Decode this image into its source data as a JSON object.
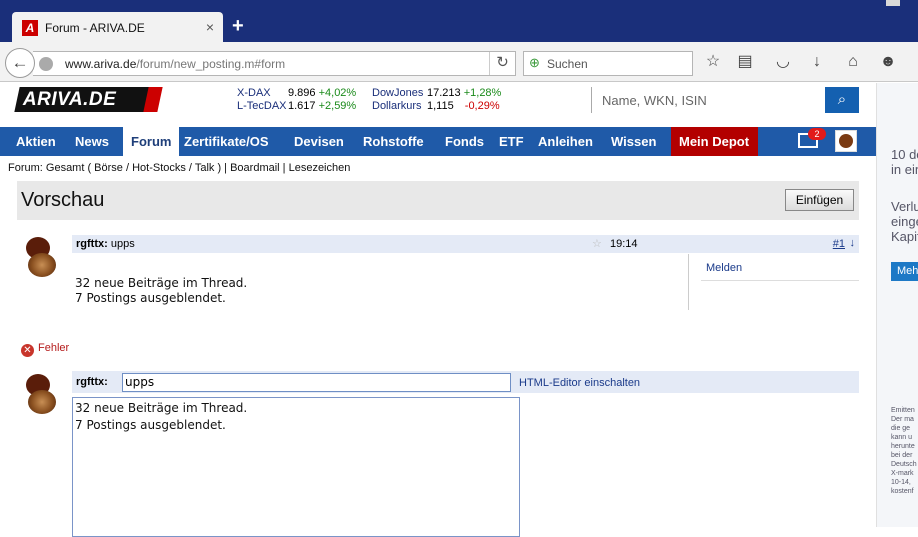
{
  "browser": {
    "tab_title": "Forum - ARIVA.DE",
    "tab_close": "×",
    "new_tab": "+",
    "url_domain": "www.ariva.de",
    "url_path": "/forum/new_posting.m#form",
    "search_placeholder": "Suchen"
  },
  "site": {
    "logo_text": "ARIVA.DE",
    "tickers": [
      {
        "name": "X-DAX",
        "value": "9.896",
        "change": "+4,02%"
      },
      {
        "name": "L-TecDAX",
        "value": "1.617",
        "change": "+2,59%"
      },
      {
        "name": "DowJones",
        "value": "17.213",
        "change": "+1,28%"
      },
      {
        "name": "Dollarkurs",
        "value": "1,115",
        "change": "-0,29%"
      }
    ],
    "search_placeholder": "Name, WKN, ISIN"
  },
  "nav": {
    "items": [
      "Aktien",
      "News",
      "Forum",
      "Zertifikate/OS",
      "Devisen",
      "Rohstoffe",
      "Fonds",
      "ETF",
      "Anleihen",
      "Wissen",
      "Mein Depot"
    ],
    "mail_count": "2"
  },
  "breadcrumb": "Forum: Gesamt ( Börse / Hot-Stocks / Talk ) | Boardmail | Lesezeichen",
  "preview": {
    "title": "Vorschau",
    "insert_label": "Einfügen"
  },
  "post": {
    "author": "rgfttx:",
    "subject": "upps",
    "time": "19:14",
    "number": "#1",
    "line1": "32 neue Beiträge im Thread.",
    "line2": "7 Postings ausgeblendet.",
    "report_label": "Melden"
  },
  "error_label": "Fehler",
  "editor": {
    "author": "rgfttx:",
    "subject_value": "upps",
    "html_editor_label": "HTML-Editor einschalten",
    "body": "32 neue Beiträge im Thread.\n7 Postings ausgeblendet."
  },
  "ad": {
    "text1a": "10 de",
    "text1b": "in ein",
    "text2a": "Verlu",
    "text2b": "einge",
    "text2c": "Kapit",
    "button": "Meh",
    "small": [
      "Emitten",
      "Der ma",
      "die ge",
      "kann u",
      "herunte",
      "bei der",
      "Deutsch",
      "X-mark",
      "10-14,",
      "kostenf"
    ]
  }
}
